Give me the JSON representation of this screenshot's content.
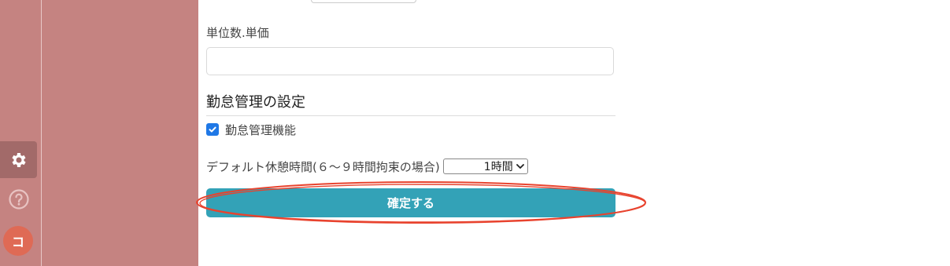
{
  "form": {
    "unit_price_label": "単位数.単価",
    "unit_price_value": "",
    "attendance_section_title": "勤怠管理の設定",
    "attendance_feature_label": "勤怠管理機能",
    "attendance_feature_checked": true,
    "default_break_label": "デフォルト休憩時間(６〜９時間拘束の場合)",
    "default_break_selected": "1時間",
    "confirm_label": "確定する"
  },
  "rail": {
    "avatar_initial": "コ"
  },
  "colors": {
    "sidebar": "#c58381",
    "primary_button": "#33a2b7",
    "checkbox": "#1f78e6",
    "avatar": "#df6a55",
    "highlight": "#e8432e"
  },
  "icons": [
    "gear-icon",
    "help-icon",
    "check-icon",
    "chevron-down-icon"
  ]
}
